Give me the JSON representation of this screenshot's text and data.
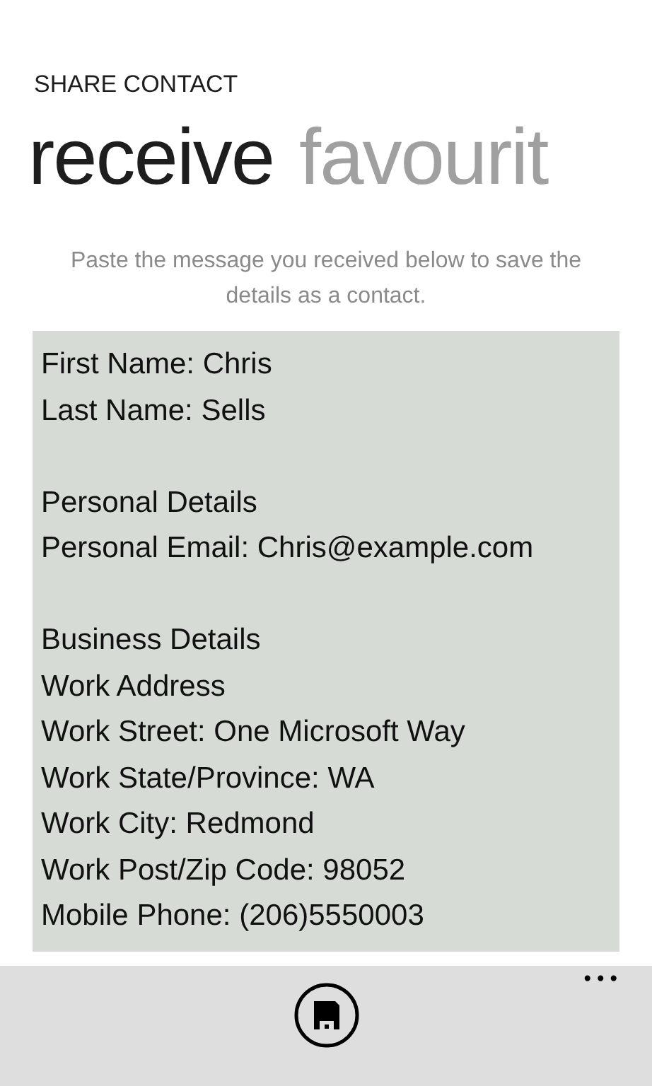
{
  "app_title": "SHARE CONTACT",
  "pivot": [
    {
      "label": "receive",
      "selected": true
    },
    {
      "label": "favourit",
      "selected": false
    }
  ],
  "instructions": "Paste the message you received below to save the details as a contact.",
  "message": {
    "paragraphs": [
      [
        "First Name: Chris",
        "Last Name: Sells"
      ],
      [
        "Personal Details",
        "Personal Email: Chris@example.com"
      ],
      [
        "Business Details",
        "Work Address",
        "Work Street: One Microsoft Way",
        "Work State/Province: WA",
        "Work City: Redmond",
        "Work Post/Zip Code: 98052",
        "Mobile Phone: (206)5550003"
      ]
    ]
  },
  "app_bar": {
    "buttons": [
      {
        "kind": "save"
      }
    ],
    "more": "•••"
  }
}
